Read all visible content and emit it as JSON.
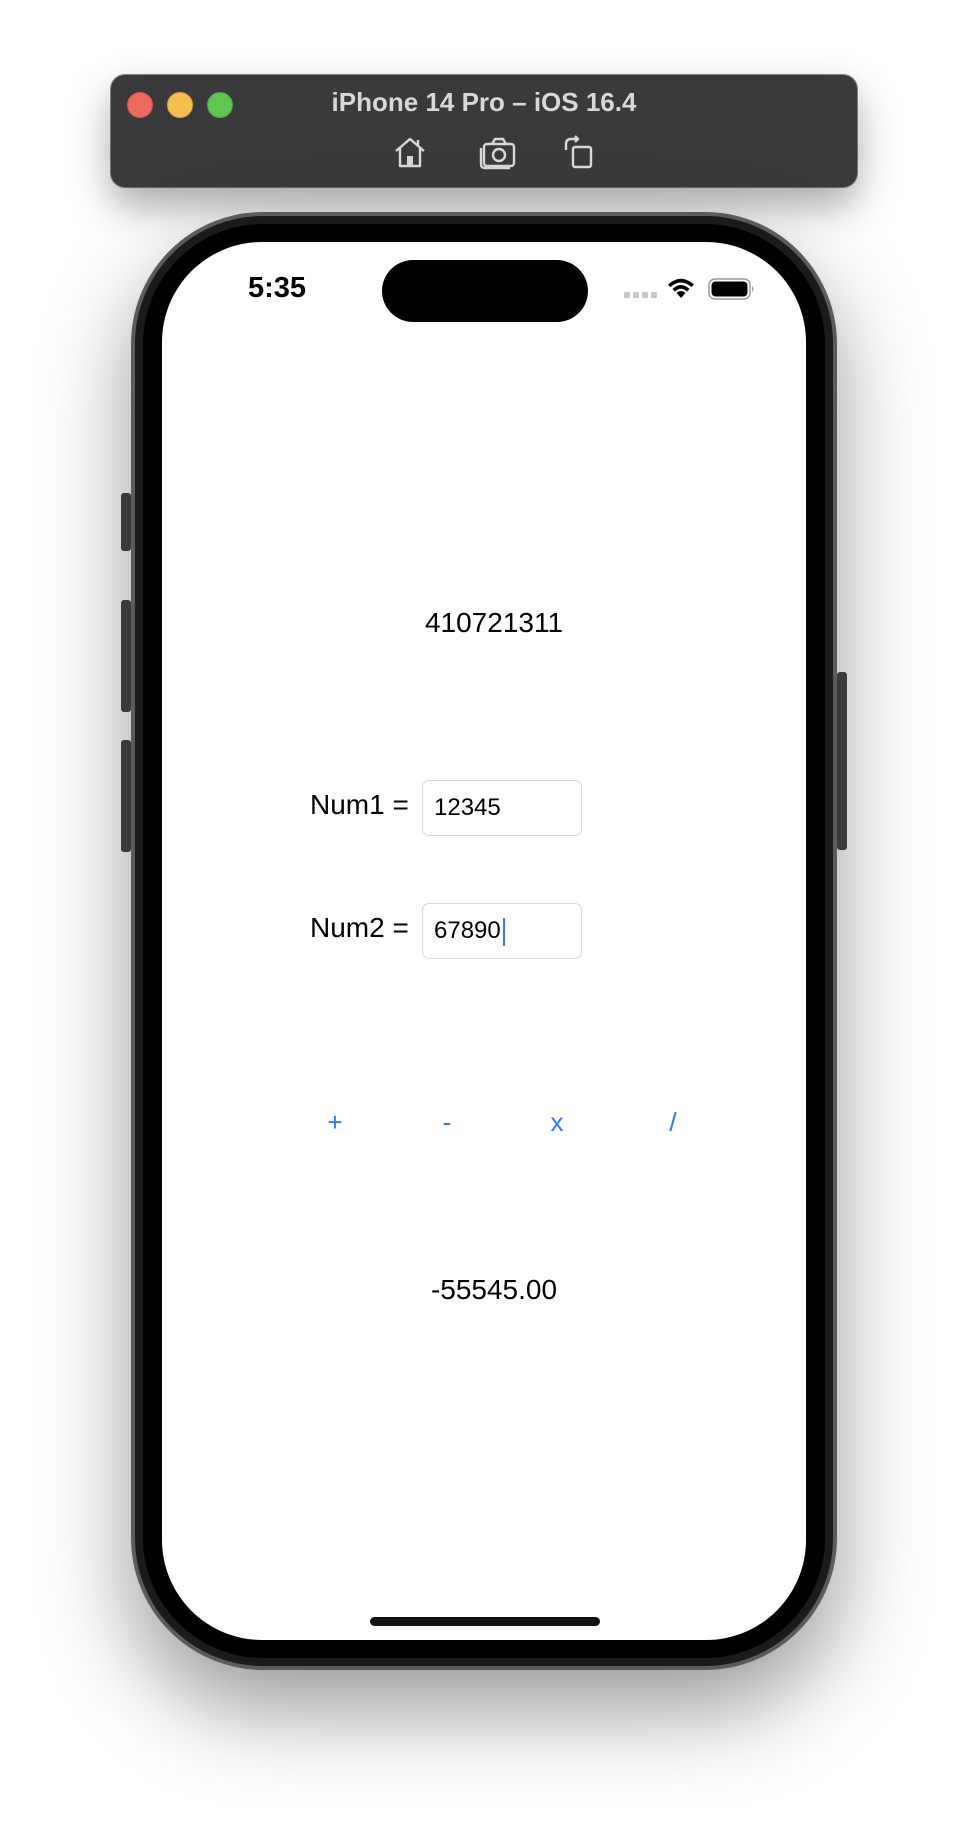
{
  "simulator": {
    "title": "iPhone 14 Pro – iOS 16.4",
    "toolbar_icons": [
      "home-icon",
      "screenshot-icon",
      "rotate-icon"
    ],
    "traffic_lights": {
      "close": "#ed6a5e",
      "minimize": "#f5bf4f",
      "maximize": "#61c554"
    }
  },
  "status_bar": {
    "time": "5:35",
    "icons": [
      "cellular-signal-icon",
      "wifi-icon",
      "battery-icon"
    ]
  },
  "app": {
    "product_value": "410721311",
    "num1": {
      "label": "Num1 =",
      "value": "12345"
    },
    "num2": {
      "label": "Num2 =",
      "value": "67890"
    },
    "operations": {
      "add": "+",
      "subtract": "-",
      "multiply": "x",
      "divide": "/"
    },
    "result": "-55545.00",
    "accent_color": "#3478f6"
  }
}
